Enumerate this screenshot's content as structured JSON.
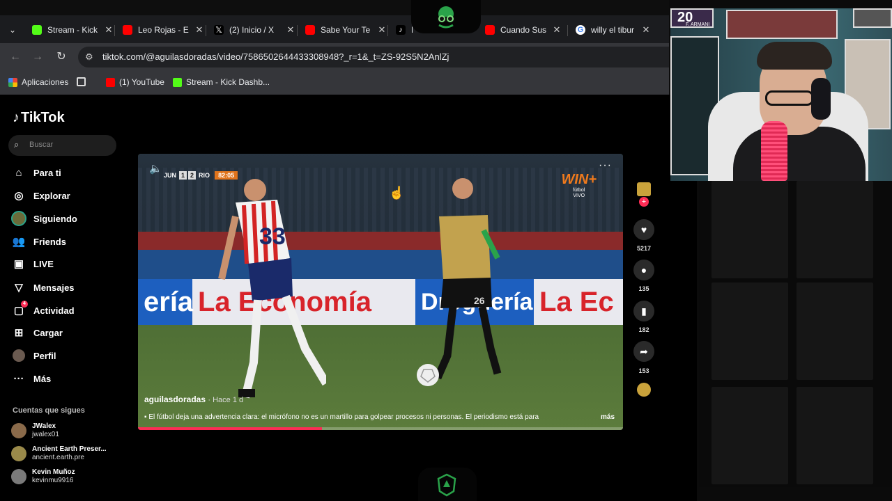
{
  "browser": {
    "tabs": [
      {
        "label": "Stream - Kick",
        "icon": "kick-icon",
        "color": "#53fc18"
      },
      {
        "label": "Leo Rojas - E",
        "icon": "youtube-icon",
        "color": "#ff0000"
      },
      {
        "label": "(2) Inicio / X",
        "icon": "x-icon",
        "color": "#000000"
      },
      {
        "label": "Sabe Your Te",
        "icon": "youtube-icon",
        "color": "#ff0000"
      },
      {
        "label": "La r",
        "icon": "tiktok-icon",
        "color": "#000000"
      },
      {
        "label": "Cuando Sus",
        "icon": "youtube-icon",
        "color": "#ff0000"
      },
      {
        "label": "willy el tibur",
        "icon": "google-icon",
        "color": "#4285f4"
      }
    ],
    "url": "tiktok.com/@aguilasdoradas/video/7586502644433308948?_r=1&_t=ZS-92S5N2AnlZj",
    "bookmarks": [
      {
        "label": "Aplicaciones",
        "icon": "apps-grid-icon"
      },
      {
        "label": "",
        "icon": "grid-icon"
      },
      {
        "label": "(1) YouTube",
        "icon": "youtube-icon"
      },
      {
        "label": "Stream - Kick Dashb...",
        "icon": "kick-icon"
      }
    ]
  },
  "tiktok": {
    "logo": "TikTok",
    "search_placeholder": "Buscar",
    "nav": [
      {
        "label": "Para ti",
        "icon": "home-icon"
      },
      {
        "label": "Explorar",
        "icon": "compass-icon"
      },
      {
        "label": "Siguiendo",
        "icon": "following-avatar-icon"
      },
      {
        "label": "Friends",
        "icon": "friends-icon"
      },
      {
        "label": "LIVE",
        "icon": "live-icon"
      },
      {
        "label": "Mensajes",
        "icon": "message-icon"
      },
      {
        "label": "Actividad",
        "icon": "activity-icon"
      },
      {
        "label": "Cargar",
        "icon": "upload-icon"
      },
      {
        "label": "Perfil",
        "icon": "profile-icon"
      },
      {
        "label": "Más",
        "icon": "more-icon"
      }
    ],
    "following_title": "Cuentas que sigues",
    "following": [
      {
        "name": "JWalex",
        "handle": "jwalex01"
      },
      {
        "name": "Ancient Earth Preser...",
        "handle": "ancient.earth.pre"
      },
      {
        "name": "Kevin Muñoz",
        "handle": "kevinmu9916"
      }
    ],
    "video": {
      "scorebug": {
        "home": "JUN",
        "home_score": "1",
        "away_score": "2",
        "away": "RIO",
        "clock": "82:05"
      },
      "broadcaster": "WIN+",
      "broadcaster_sub": "fútbol",
      "broadcaster_live": "VIVO",
      "ad_text_1": "ería",
      "ad_text_2": "La Economía",
      "ad_text_3": "Droguería",
      "ad_text_4": "La Ec",
      "username": "aguilasdoradas",
      "posted": "· Hace 1 d",
      "caption": "El fútbol deja una advertencia clara: el micrófono no es un martillo para golpear procesos ni personas. El periodismo está para",
      "more_label": "más",
      "progress": 0.38,
      "jersey_left": "33",
      "jersey_right": "26"
    },
    "actions": {
      "likes": "5217",
      "comments": "135",
      "saves": "182",
      "shares": "153"
    }
  },
  "webcam": {
    "poster_number": "20",
    "poster_label": "F. ARMANI"
  }
}
